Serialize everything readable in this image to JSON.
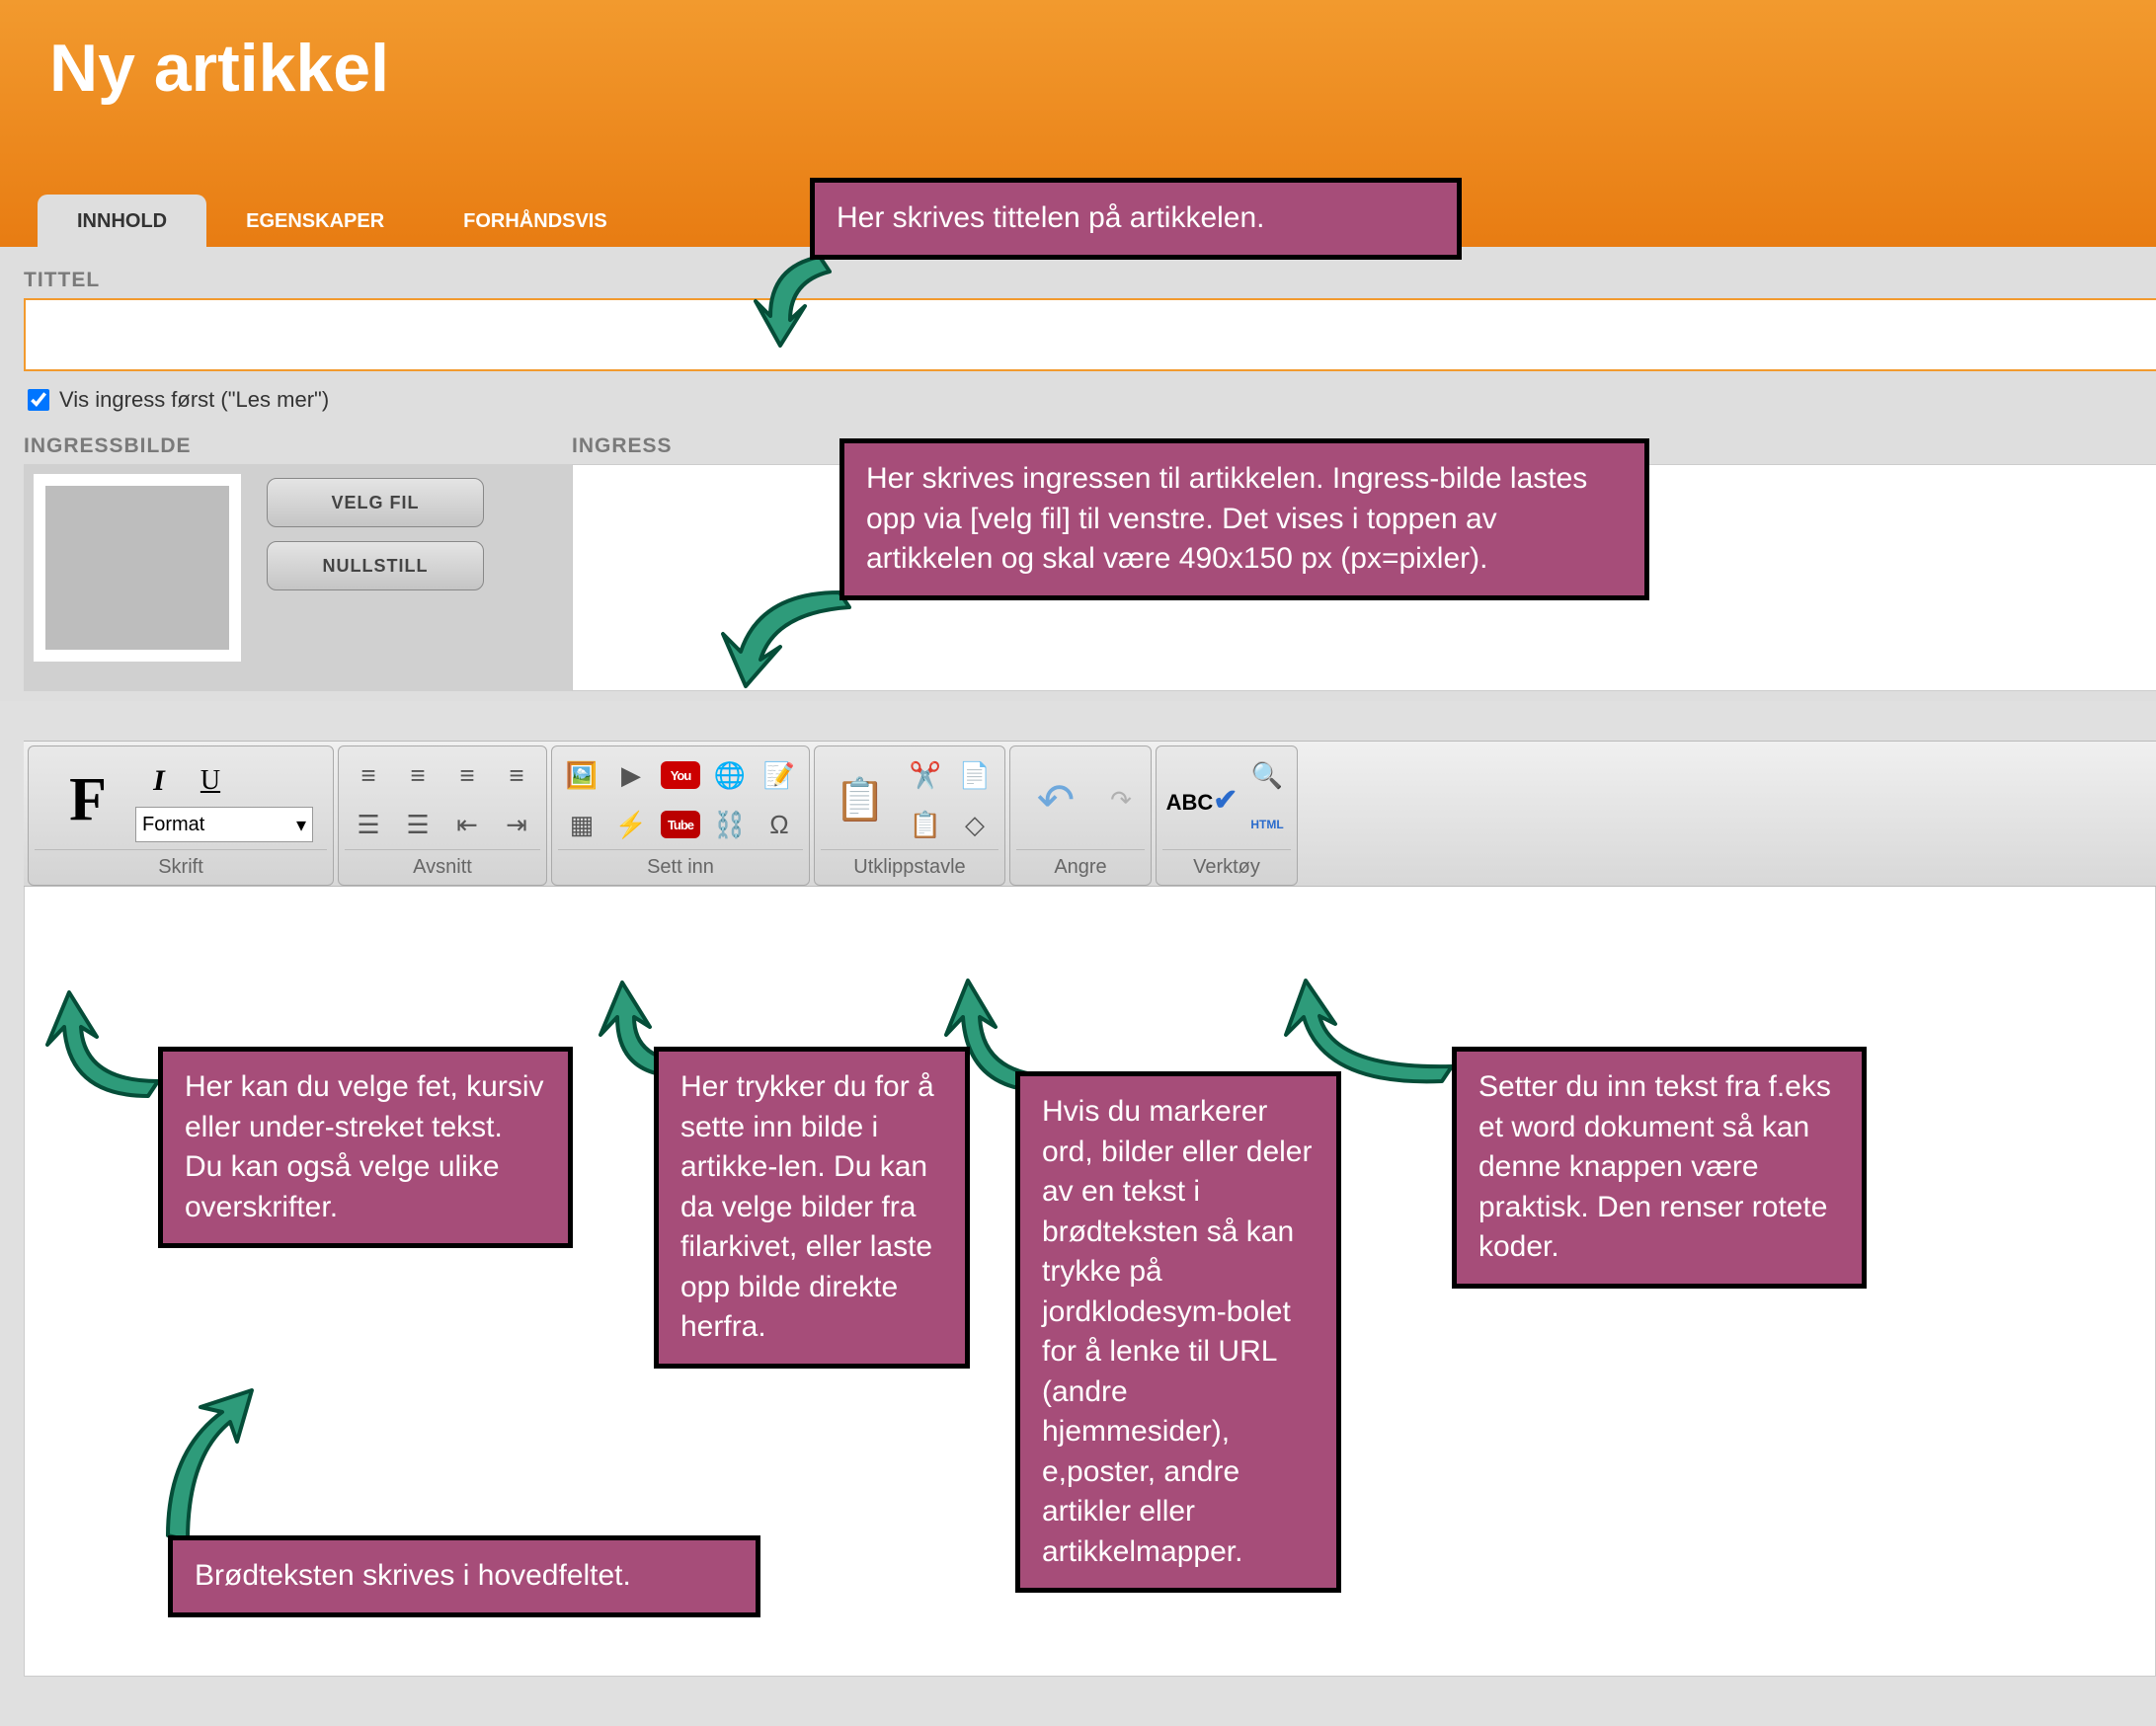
{
  "header": {
    "title": "Ny artikkel"
  },
  "tabs": {
    "innhold": "INNHOLD",
    "egenskaper": "EGENSKAPER",
    "forhandsvis": "FORHÅNDSVIS"
  },
  "fields": {
    "tittel_label": "TITTEL",
    "tittel_value": "",
    "vis_ingress_label": "Vis ingress først (\"Les mer\")",
    "ingressbilde_label": "INGRESSBILDE",
    "ingress_label": "INGRESS"
  },
  "buttons": {
    "velg_fil": "VELG FIL",
    "nullstill": "NULLSTILL"
  },
  "toolbar": {
    "format_label": "Format",
    "groups": {
      "skrift": "Skrift",
      "avsnitt": "Avsnitt",
      "settinn": "Sett inn",
      "utklipp": "Utklippstavle",
      "angre": "Angre",
      "verktoy": "Verktøy"
    }
  },
  "callouts": {
    "tittel": "Her skrives tittelen på artikkelen.",
    "ingress": "Her skrives ingressen til artikkelen. Ingress-bilde lastes opp via [velg fil] til venstre. Det vises i toppen av artikkelen og skal være 490x150 px (px=pixler).",
    "skrift": "Her kan du velge fet, kursiv eller under-streket tekst. Du kan også velge ulike overskrifter.",
    "bilde": "Her trykker du for å sette inn bilde i artikke-len. Du kan da velge bilder fra filarkivet, eller laste opp bilde direkte herfra.",
    "lenke": "Hvis du markerer ord, bilder eller deler av en tekst i brødteksten så kan trykke på jordklodesym-bolet for å lenke til URL (andre hjemmesider), e,poster, andre artikler eller artikkelmapper.",
    "paste": "Setter du inn tekst fra f.eks et word dokument så kan denne knappen være praktisk. Den renser rotete koder.",
    "brodtekst": "Brødteksten skrives i hovedfeltet."
  }
}
